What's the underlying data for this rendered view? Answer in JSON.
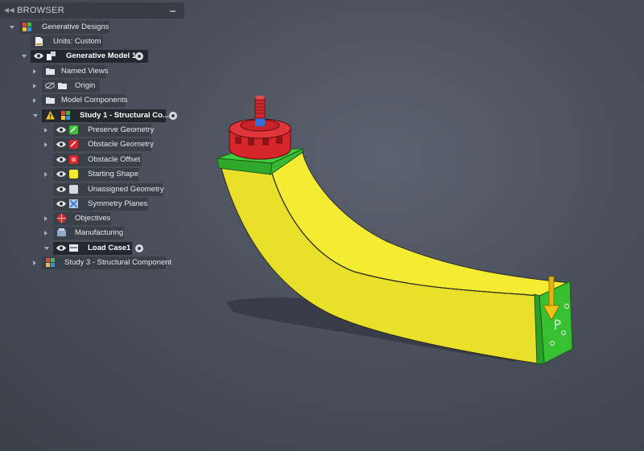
{
  "browser": {
    "title": "BROWSER",
    "items": [
      {
        "label": "Generative Designs",
        "icon": "generative-designs-icon"
      },
      {
        "label": "Units: Custom",
        "icon": "units-document-icon"
      },
      {
        "label": "Generative Model 1",
        "icon": "model-icon"
      },
      {
        "label": "Named Views",
        "icon": "folder-icon"
      },
      {
        "label": "Origin",
        "icon": "folder-icon"
      },
      {
        "label": "Model Components",
        "icon": "folder-icon"
      },
      {
        "label": "Study 1 - Structural Co...",
        "icon": "study-icon",
        "warning": "warning-icon"
      },
      {
        "label": "Preserve Geometry",
        "icon": "preserve-geometry-icon"
      },
      {
        "label": "Obstacle Geometry",
        "icon": "obstacle-geometry-icon"
      },
      {
        "label": "Obstacle Offset",
        "icon": "obstacle-offset-icon"
      },
      {
        "label": "Starting Shape",
        "icon": "starting-shape-icon"
      },
      {
        "label": "Unassigned Geometry",
        "icon": "unassigned-geometry-icon"
      },
      {
        "label": "Symmetry Planes",
        "icon": "symmetry-planes-icon"
      },
      {
        "label": "Objectives",
        "icon": "objectives-icon"
      },
      {
        "label": "Manufacturing",
        "icon": "manufacturing-icon"
      },
      {
        "label": "Load Case1",
        "icon": "load-case-icon"
      },
      {
        "label": "Study 3 - Structural Component",
        "icon": "study-icon"
      }
    ]
  },
  "colors": {
    "preserve_green": "#3fbf3a",
    "starting_yellow": "#f2ea2e",
    "obstacle_red": "#d8262b",
    "load_arrow": "#e7b80e"
  }
}
